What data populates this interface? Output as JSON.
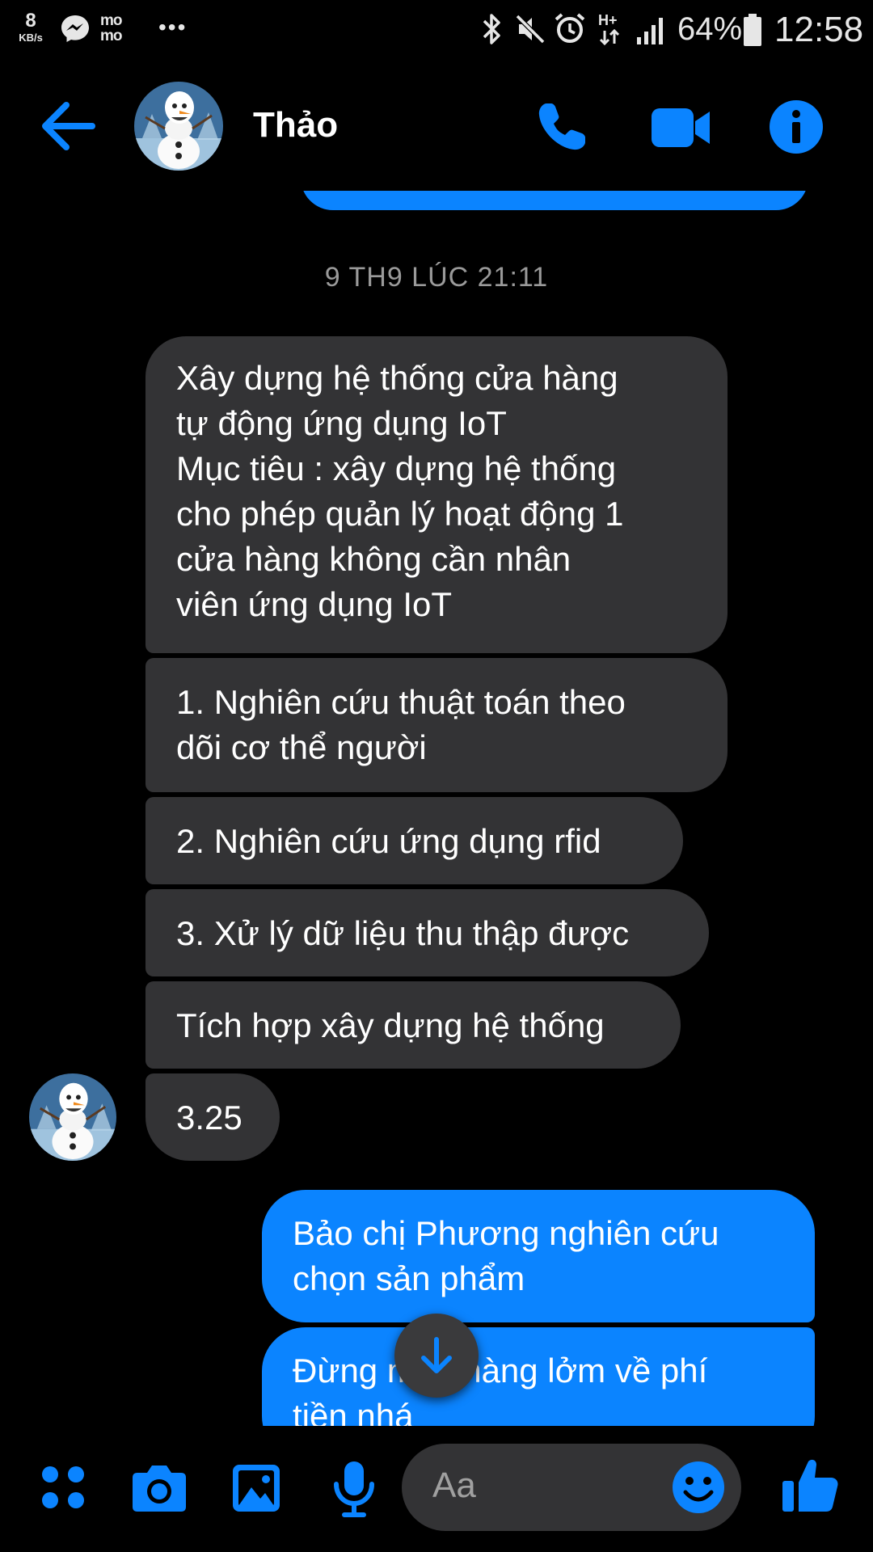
{
  "status_bar": {
    "net_speed_value": "8",
    "net_speed_unit": "KB/s",
    "momo_logo_text": "mo mo",
    "overflow": "•••",
    "battery": "64%",
    "time": "12:58"
  },
  "header": {
    "contact_name": "Thảo"
  },
  "thread": {
    "timestamp": "9 TH9 LÚC 21:11",
    "incoming": [
      {
        "text": "Xây dựng hệ thống cửa hàng\ntự động ứng dụng IoT\nMục tiêu : xây dựng hệ thống\ncho phép quản lý hoạt động 1\ncửa hàng không cần nhân\nviên ứng dụng IoT"
      },
      {
        "text": "1. Nghiên cứu thuật toán theo\ndõi cơ thể người"
      },
      {
        "text": "2. Nghiên cứu ứng dụng rfid"
      },
      {
        "text": "3. Xử lý dữ liệu thu thập được"
      },
      {
        "text": "Tích hợp xây dựng hệ thống"
      },
      {
        "text": "3.25"
      }
    ],
    "outgoing": [
      {
        "text": "Bảo chị Phương nghiên cứu\nchọn sản phẩm"
      },
      {
        "text": "Đừng mua hàng lởm về phí\ntiền nhá"
      }
    ]
  },
  "composer": {
    "placeholder": "Aa"
  },
  "colors": {
    "accent": "#0b84ff",
    "incoming_bubble": "#333335",
    "background": "#000000"
  }
}
